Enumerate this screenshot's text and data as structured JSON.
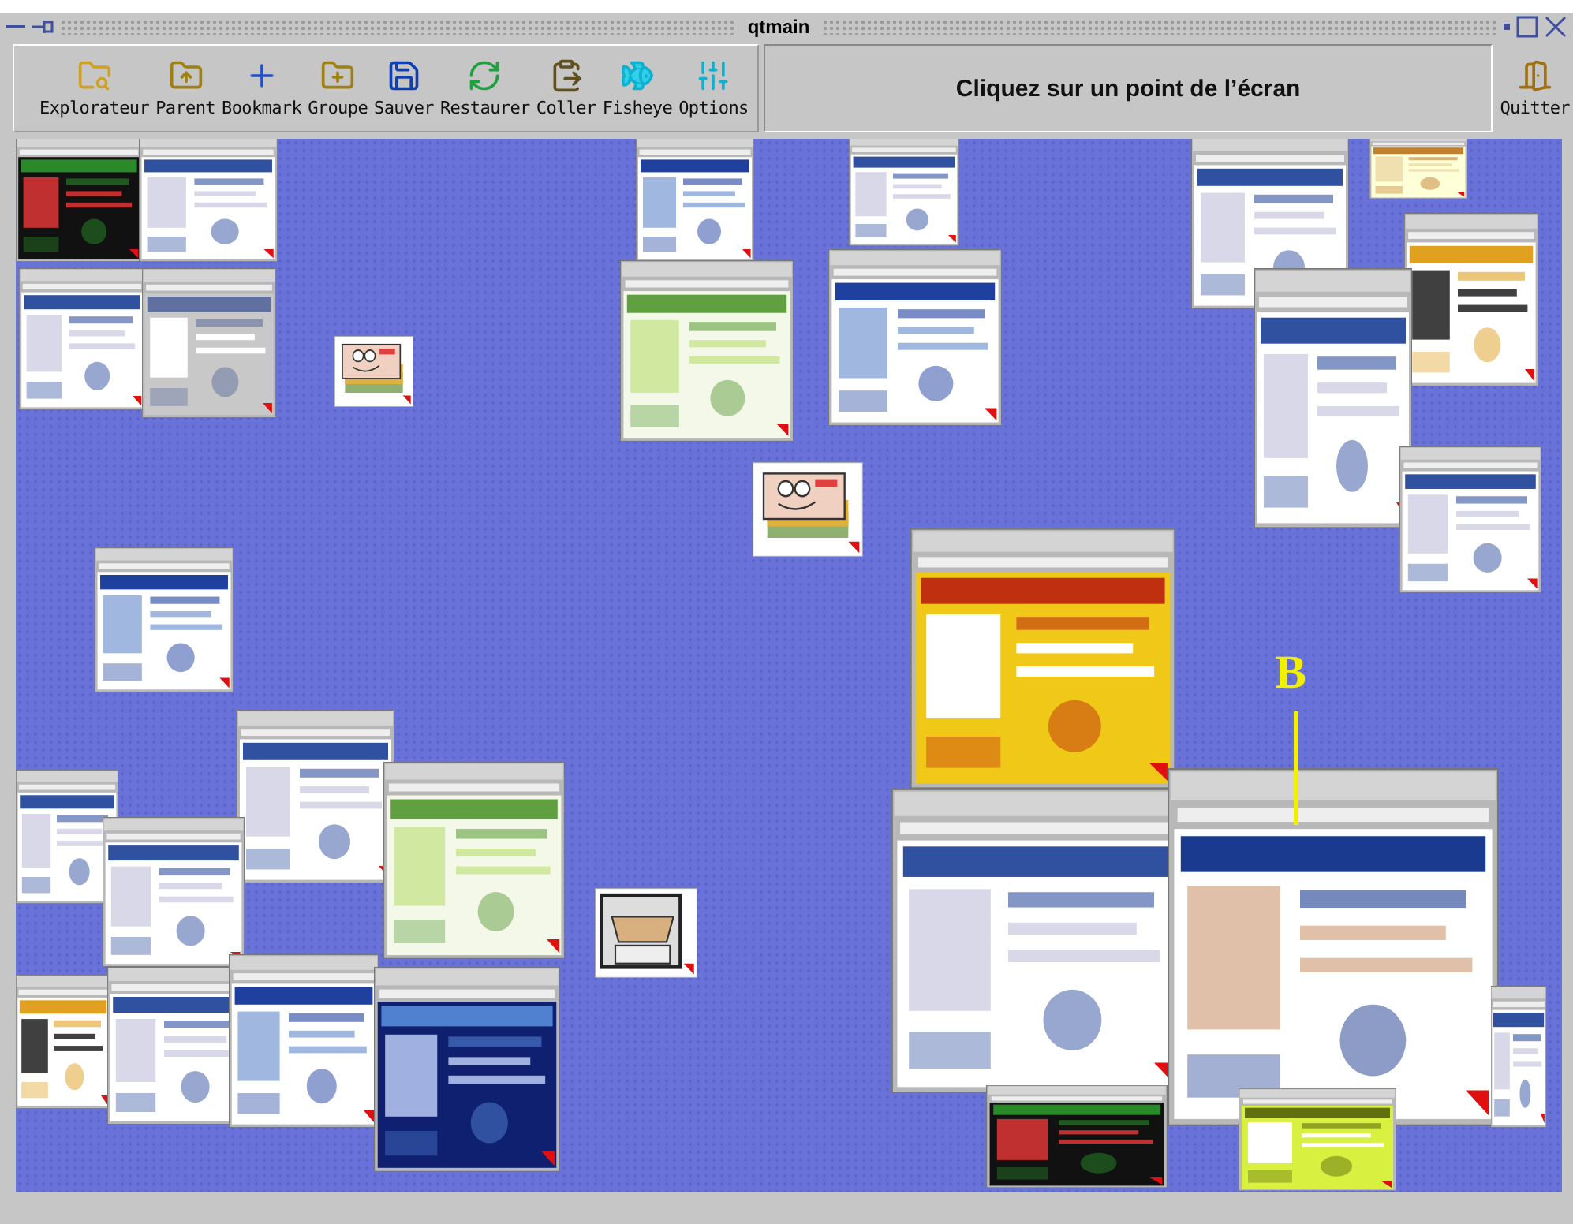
{
  "window": {
    "title": "qtmain"
  },
  "toolbar": {
    "buttons": [
      {
        "label": "Explorateur"
      },
      {
        "label": "Parent"
      },
      {
        "label": "Bookmark"
      },
      {
        "label": "Groupe"
      },
      {
        "label": "Sauver"
      },
      {
        "label": "Restaurer"
      },
      {
        "label": "Coller"
      },
      {
        "label": "Fisheye"
      },
      {
        "label": "Options"
      }
    ],
    "message": "Cliquez sur un point de l’écran",
    "quit": {
      "label": "Quitter"
    }
  },
  "annotation": {
    "label": "B"
  }
}
